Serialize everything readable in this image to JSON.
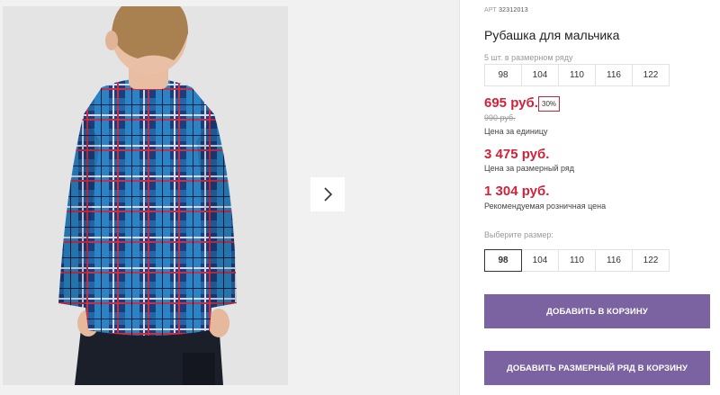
{
  "product": {
    "art_label": "АРТ",
    "art_number": "32312013",
    "title": "Рубашка для мальчика"
  },
  "series": {
    "label": "5 шт. в размерном ряду",
    "sizes": [
      "98",
      "104",
      "110",
      "116",
      "122"
    ]
  },
  "pricing": {
    "unit_price": "695 руб.",
    "discount": "30%",
    "old_price": "990 руб.",
    "unit_note": "Цена за единицу",
    "series_price": "3 475 руб.",
    "series_note": "Цена за размерный ряд",
    "retail_price": "1 304 руб.",
    "retail_note": "Рекомендуемая розничная цена",
    "accent_color": "#d0233a"
  },
  "size_select": {
    "label": "Выберите размер:",
    "options": [
      "98",
      "104",
      "110",
      "116",
      "122"
    ],
    "selected": "98"
  },
  "actions": {
    "add_to_cart": "ДОБАВИТЬ В КОРЗИНУ",
    "add_series_to_cart": "ДОБАВИТЬ РАЗМЕРНЫЙ РЯД В КОРЗИНУ",
    "button_color": "#7b63a2"
  },
  "gallery": {
    "next_icon": "chevron-right-icon"
  }
}
